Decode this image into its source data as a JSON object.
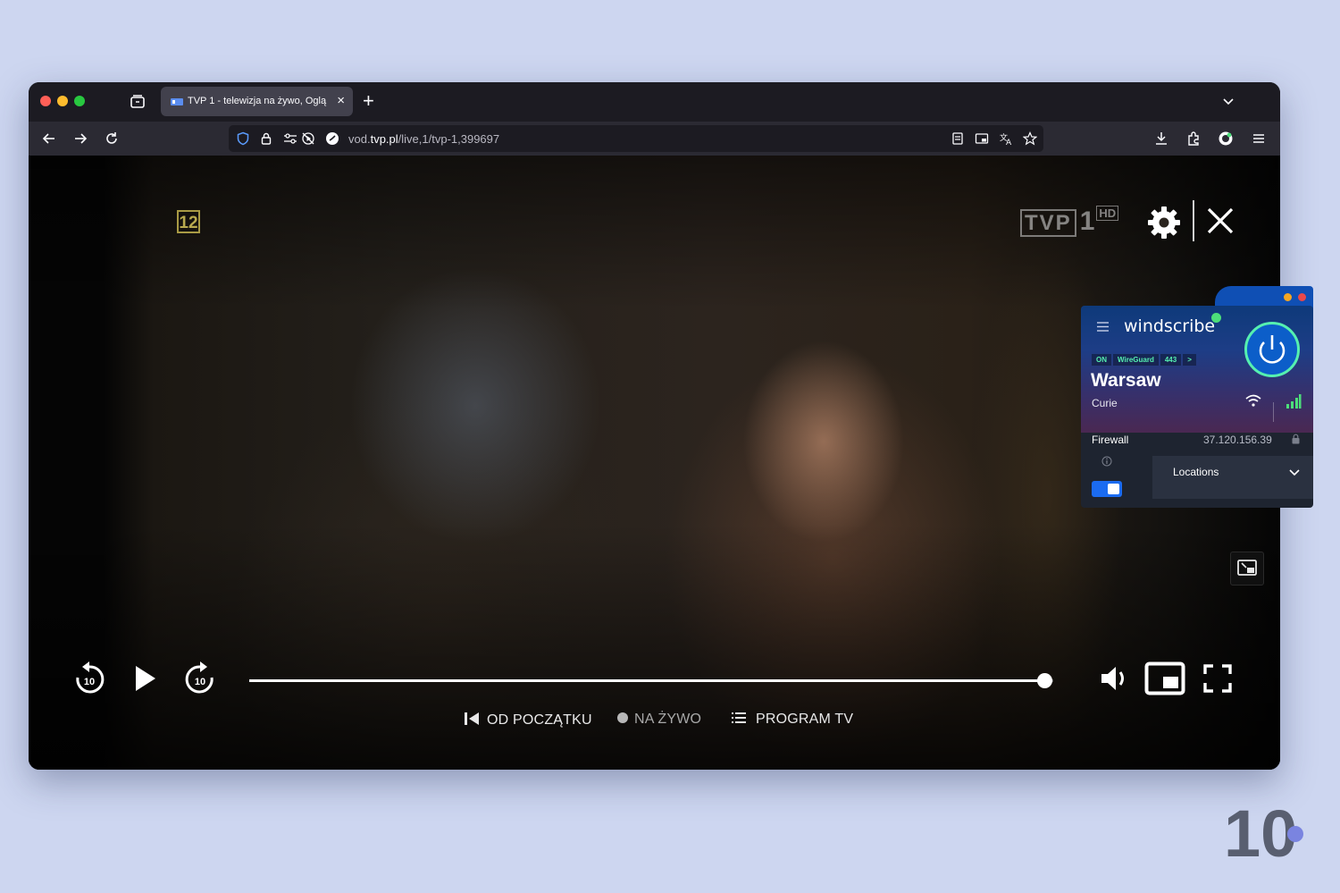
{
  "browser": {
    "tab": {
      "title": "TVP 1 - telewizja na żywo, Oglą",
      "close": "×"
    },
    "new_tab": "+",
    "url": {
      "prefix": "vod.",
      "domain": "tvp.pl",
      "path": "/live,1/tvp-1,399697"
    }
  },
  "player": {
    "rating": "12",
    "channel": {
      "name": "TVP",
      "number": "1",
      "quality": "HD"
    },
    "progress_fraction": 0.9889,
    "skip_back": "10",
    "skip_forward": "10",
    "links": {
      "from_start": "OD POCZĄTKU",
      "live": "NA ŻYWO",
      "program": "PROGRAM TV"
    }
  },
  "windscribe": {
    "brand": "windscribe",
    "status": [
      "ON",
      "WireGuard",
      "443",
      ">"
    ],
    "city": "Warsaw",
    "node": "Curie",
    "firewall_label": "Firewall",
    "ip": "37.120.156.39",
    "locations_label": "Locations",
    "firewall_on": true
  },
  "watermark": "10",
  "colors": {
    "page_bg": "#cdd6f0",
    "tab_active": "#42414d",
    "windscribe_green": "#55f0b0",
    "windscribe_blue": "#0c5ec9",
    "toggle_blue": "#1b6bf0"
  }
}
